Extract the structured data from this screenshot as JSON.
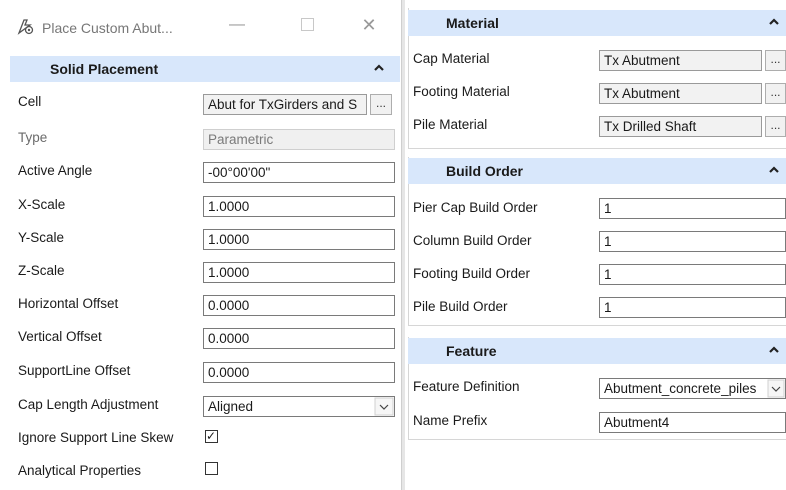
{
  "window": {
    "title": "Place Custom Abut...",
    "minimize_glyph": "—",
    "close_glyph": "✕"
  },
  "solid_placement": {
    "header": "Solid Placement",
    "cell": {
      "label": "Cell",
      "value": "Abut for TxGirders and S",
      "browse": "..."
    },
    "type": {
      "label": "Type",
      "value": "Parametric"
    },
    "active_angle": {
      "label": "Active Angle",
      "value": "-00°00'00\""
    },
    "x_scale": {
      "label": "X-Scale",
      "value": "1.0000"
    },
    "y_scale": {
      "label": "Y-Scale",
      "value": "1.0000"
    },
    "z_scale": {
      "label": "Z-Scale",
      "value": "1.0000"
    },
    "horizontal_offset": {
      "label": "Horizontal Offset",
      "value": "0.0000"
    },
    "vertical_offset": {
      "label": "Vertical Offset",
      "value": "0.0000"
    },
    "supportline_offset": {
      "label": "SupportLine Offset",
      "value": "0.0000"
    },
    "cap_length_adjustment": {
      "label": "Cap Length Adjustment",
      "value": "Aligned"
    },
    "ignore_support_line_skew": {
      "label": "Ignore Support Line Skew",
      "checked": true,
      "check_glyph": "✓"
    },
    "analytical_properties": {
      "label": "Analytical Properties",
      "checked": false
    }
  },
  "material": {
    "header": "Material",
    "cap": {
      "label": "Cap Material",
      "value": "Tx Abutment",
      "browse": "..."
    },
    "footing": {
      "label": "Footing Material",
      "value": "Tx Abutment",
      "browse": "..."
    },
    "pile": {
      "label": "Pile Material",
      "value": "Tx Drilled Shaft",
      "browse": "..."
    }
  },
  "build_order": {
    "header": "Build Order",
    "pier_cap": {
      "label": "Pier Cap Build Order",
      "value": "1"
    },
    "column": {
      "label": "Column Build Order",
      "value": "1"
    },
    "footing": {
      "label": "Footing Build Order",
      "value": "1"
    },
    "pile": {
      "label": "Pile Build Order",
      "value": "1"
    }
  },
  "feature": {
    "header": "Feature",
    "definition": {
      "label": "Feature Definition",
      "value": "Abutment_concrete_piles"
    },
    "name_prefix": {
      "label": "Name Prefix",
      "value": "Abutment4"
    }
  },
  "colors": {
    "section_header_bg": "#d8e7fb",
    "disabled_text": "#7a7a7a"
  },
  "icons": [
    "tool-icon",
    "minimize-icon",
    "maximize-icon",
    "close-icon",
    "collapse-caret-icon",
    "chevron-down-icon",
    "checkmark-icon"
  ]
}
